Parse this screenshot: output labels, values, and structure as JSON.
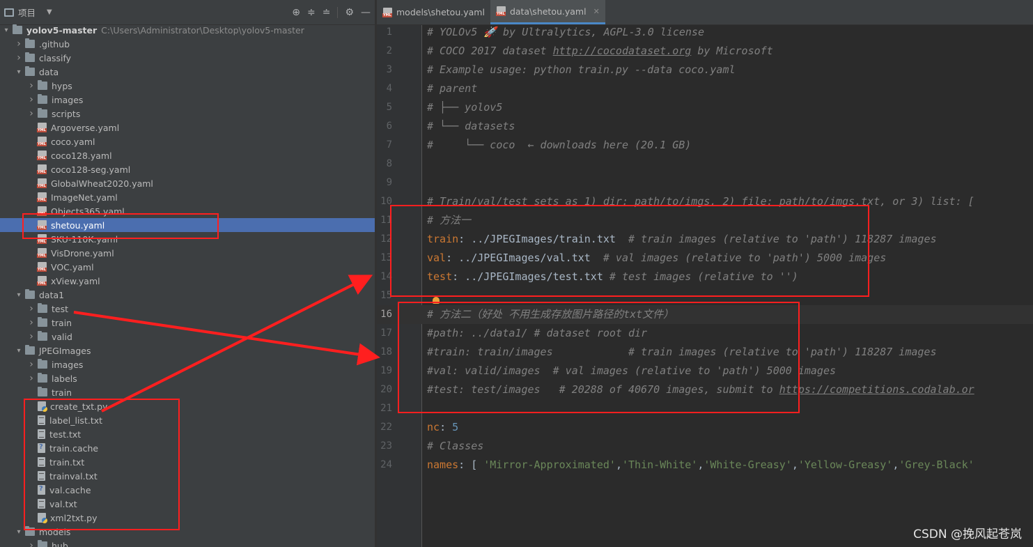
{
  "project": {
    "title": "项目",
    "tree": [
      {
        "name": "yolov5-master",
        "type": "folder",
        "depth": 0,
        "expanded": true,
        "bold": true,
        "path": "C:\\Users\\Administrator\\Desktop\\yolov5-master"
      },
      {
        "name": ".github",
        "type": "folder",
        "depth": 1,
        "expanded": false
      },
      {
        "name": "classify",
        "type": "folder",
        "depth": 1,
        "expanded": false
      },
      {
        "name": "data",
        "type": "folder",
        "depth": 1,
        "expanded": true
      },
      {
        "name": "hyps",
        "type": "folder",
        "depth": 2,
        "expanded": false
      },
      {
        "name": "images",
        "type": "folder",
        "depth": 2,
        "expanded": false
      },
      {
        "name": "scripts",
        "type": "folder",
        "depth": 2,
        "expanded": false
      },
      {
        "name": "Argoverse.yaml",
        "type": "yml",
        "depth": 2
      },
      {
        "name": "coco.yaml",
        "type": "yml",
        "depth": 2
      },
      {
        "name": "coco128.yaml",
        "type": "yml",
        "depth": 2
      },
      {
        "name": "coco128-seg.yaml",
        "type": "yml",
        "depth": 2
      },
      {
        "name": "GlobalWheat2020.yaml",
        "type": "yml",
        "depth": 2
      },
      {
        "name": "ImageNet.yaml",
        "type": "yml",
        "depth": 2
      },
      {
        "name": "Objects365.yaml",
        "type": "yml",
        "depth": 2
      },
      {
        "name": "shetou.yaml",
        "type": "yml",
        "depth": 2,
        "selected": true
      },
      {
        "name": "SKU-110K.yaml",
        "type": "yml",
        "depth": 2
      },
      {
        "name": "VisDrone.yaml",
        "type": "yml",
        "depth": 2
      },
      {
        "name": "VOC.yaml",
        "type": "yml",
        "depth": 2
      },
      {
        "name": "xView.yaml",
        "type": "yml",
        "depth": 2
      },
      {
        "name": "data1",
        "type": "folder",
        "depth": 1,
        "expanded": true
      },
      {
        "name": "test",
        "type": "folder",
        "depth": 2,
        "expanded": false
      },
      {
        "name": "train",
        "type": "folder",
        "depth": 2,
        "expanded": false
      },
      {
        "name": "valid",
        "type": "folder",
        "depth": 2,
        "expanded": false
      },
      {
        "name": "JPEGImages",
        "type": "folder",
        "depth": 1,
        "expanded": true
      },
      {
        "name": "images",
        "type": "folder",
        "depth": 2,
        "expanded": false
      },
      {
        "name": "labels",
        "type": "folder",
        "depth": 2,
        "expanded": false
      },
      {
        "name": "train",
        "type": "folder",
        "depth": 2,
        "leaf": true
      },
      {
        "name": "create_txt.py",
        "type": "py",
        "depth": 2
      },
      {
        "name": "label_list.txt",
        "type": "txt",
        "depth": 2
      },
      {
        "name": "test.txt",
        "type": "txt",
        "depth": 2
      },
      {
        "name": "train.cache",
        "type": "cache",
        "depth": 2
      },
      {
        "name": "train.txt",
        "type": "txt",
        "depth": 2
      },
      {
        "name": "trainval.txt",
        "type": "txt",
        "depth": 2
      },
      {
        "name": "val.cache",
        "type": "cache",
        "depth": 2
      },
      {
        "name": "val.txt",
        "type": "txt",
        "depth": 2
      },
      {
        "name": "xml2txt.py",
        "type": "py",
        "depth": 2
      },
      {
        "name": "models",
        "type": "folder",
        "depth": 1,
        "expanded": true
      },
      {
        "name": "hub",
        "type": "folder",
        "depth": 2,
        "expanded": false
      }
    ]
  },
  "editor": {
    "tabs": [
      {
        "label": "models\\shetou.yaml",
        "active": false
      },
      {
        "label": "data\\shetou.yaml",
        "active": true
      }
    ],
    "current_line": 16,
    "lines": [
      [
        [
          "# YOLOv5 🚀 by Ultralytics, AGPL-3.0 license",
          "cm"
        ]
      ],
      [
        [
          "# COCO 2017 dataset ",
          "cm"
        ],
        [
          "http://cocodataset.org",
          "cm lnk"
        ],
        [
          " by Microsoft",
          "cm"
        ]
      ],
      [
        [
          "# Example usage: python train.py --data coco.yaml",
          "cm"
        ]
      ],
      [
        [
          "# parent",
          "cm"
        ]
      ],
      [
        [
          "# ├── yolov5",
          "cm"
        ]
      ],
      [
        [
          "# └── datasets",
          "cm"
        ]
      ],
      [
        [
          "#     └── coco  ← downloads here (20.1 GB)",
          "cm"
        ]
      ],
      [],
      [],
      [
        [
          "# Train/val/test sets as 1) dir: path/to/imgs, 2) file: path/to/imgs.txt, or 3) list: [",
          "cm"
        ]
      ],
      [
        [
          "# 方法一",
          "cm"
        ]
      ],
      [
        [
          "train",
          "key"
        ],
        [
          ": ../JPEGImages/train.txt  ",
          ""
        ],
        [
          "# train images (relative to 'path') 118287 images",
          "cm"
        ]
      ],
      [
        [
          "val",
          "key"
        ],
        [
          ": ../JPEGImages/val.txt  ",
          ""
        ],
        [
          "# val images (relative to 'path') 5000 images",
          "cm"
        ]
      ],
      [
        [
          "test",
          "key"
        ],
        [
          ": ../JPEGImages/test.txt ",
          ""
        ],
        [
          "# test images (relative to '')",
          "cm"
        ]
      ],
      [],
      [
        [
          "# 方法二（好处 不用生成存放图片路径的txt文件）",
          "cm"
        ]
      ],
      [
        [
          "#path: ../data1/ # dataset root dir",
          "cm"
        ]
      ],
      [
        [
          "#train: train/images            # train images (relative to 'path') 118287 images",
          "cm"
        ]
      ],
      [
        [
          "#val: valid/images  # val images (relative to 'path') 5000 images",
          "cm"
        ]
      ],
      [
        [
          "#test: test/images   # 20288 of 40670 images, submit to ",
          "cm"
        ],
        [
          "https://competitions.codalab.or",
          "cm lnk"
        ]
      ],
      [],
      [
        [
          "nc",
          "key"
        ],
        [
          ": ",
          ""
        ],
        [
          "5",
          "num"
        ]
      ],
      [
        [
          "# Classes",
          "cm"
        ]
      ],
      [
        [
          "names",
          "key"
        ],
        [
          ": [ ",
          ""
        ],
        [
          "'Mirror-Approximated'",
          "str"
        ],
        [
          ",",
          ""
        ],
        [
          "'Thin-White'",
          "str"
        ],
        [
          ",",
          ""
        ],
        [
          "'White-Greasy'",
          "str"
        ],
        [
          ",",
          ""
        ],
        [
          "'Yellow-Greasy'",
          "str"
        ],
        [
          ",",
          ""
        ],
        [
          "'Grey-Black'",
          "str"
        ]
      ]
    ]
  },
  "watermark": "CSDN @挽风起苍岚",
  "annotation_color": "#ff1f1f"
}
